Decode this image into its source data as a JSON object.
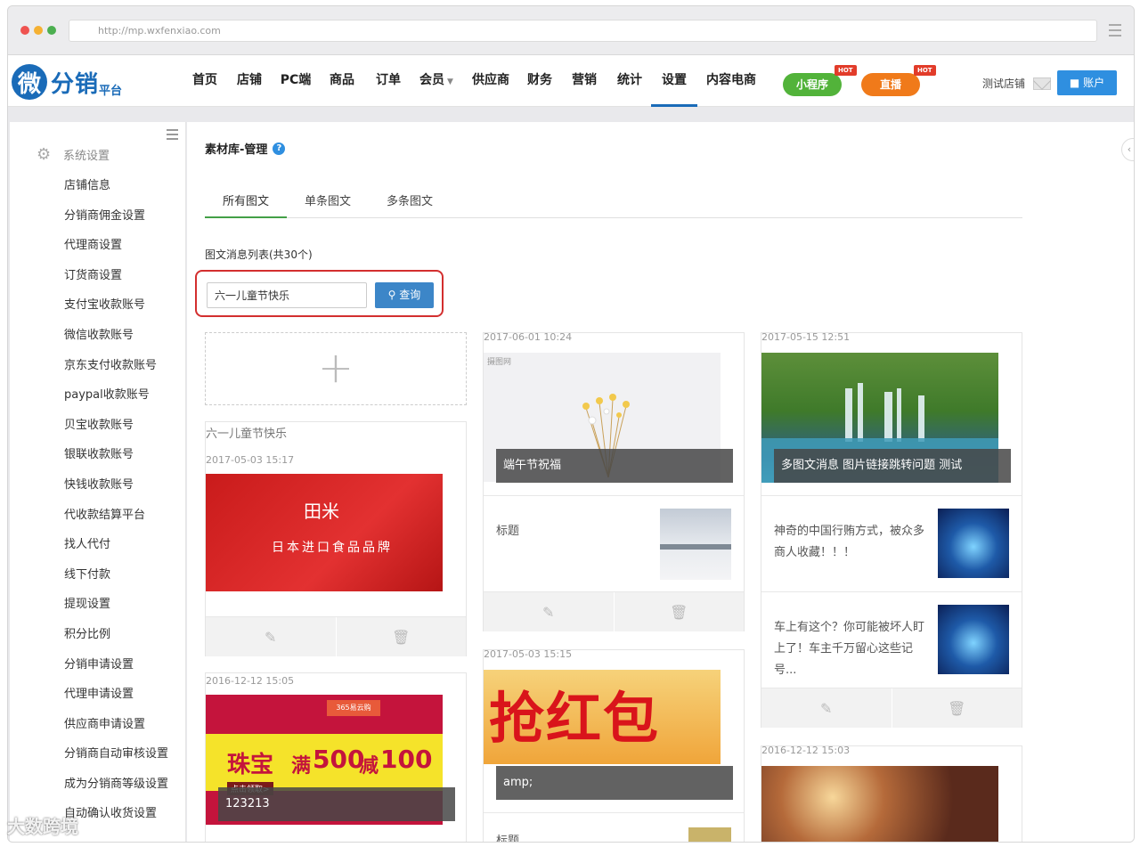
{
  "browser": {
    "url": "http://mp.wxfenxiao.com"
  },
  "header": {
    "logo_mark": "微",
    "logo_text": "分销",
    "logo_sub": "平台",
    "nav": [
      "首页",
      "店铺",
      "PC端",
      "商品",
      "订单",
      "会员",
      "供应商",
      "财务",
      "营销",
      "统计",
      "设置",
      "内容电商"
    ],
    "active_nav": "设置",
    "mini_program": "小程序",
    "live": "直播",
    "hot": "HOT",
    "store_name": "测试店铺",
    "account": "账户"
  },
  "sidebar": {
    "section": "系统设置",
    "items": [
      "店铺信息",
      "分销商佣金设置",
      "代理商设置",
      "订货商设置",
      "支付宝收款账号",
      "微信收款账号",
      "京东支付收款账号",
      "paypal收款账号",
      "贝宝收款账号",
      "银联收款账号",
      "快钱收款账号",
      "代收款结算平台",
      "找人代付",
      "线下付款",
      "提现设置",
      "积分比例",
      "分销申请设置",
      "代理申请设置",
      "供应商申请设置",
      "分销商自动审核设置",
      "成为分销商等级设置",
      "自动确认收货设置"
    ]
  },
  "main": {
    "title": "素材库-管理",
    "tabs": [
      "所有图文",
      "单条图文",
      "多条图文"
    ],
    "list_count": "图文消息列表(共30个)",
    "search_value": "六一儿童节快乐",
    "search_button": "查询",
    "add_symbol": "+"
  },
  "cards": {
    "c1": {
      "title": "六一儿童节快乐",
      "date": "2017-05-03 15:17",
      "image_caption": "日本进口食品品牌",
      "image_logo": "田米"
    },
    "c2": {
      "date": "2016-12-12 15:05",
      "overlay": "123213",
      "image_text_main": "珠宝",
      "image_text_full": "满",
      "image_text_num1": "500",
      "image_text_minus": "减",
      "image_text_num2": "100",
      "image_tag": "点击领取>",
      "image_badge": "365易云购"
    },
    "c3": {
      "date": "2017-06-01 10:24",
      "overlay": "端午节祝福",
      "sub_title": "标题",
      "image_mark": "摄图网"
    },
    "c4": {
      "date": "2017-05-03 15:15",
      "overlay": "amp;",
      "image_text": "抢红包",
      "sub_peek": "标题"
    },
    "c5": {
      "date": "2017-05-15 12:51",
      "overlay": "多图文消息 图片链接跳转问题 测试",
      "sub1": "神奇的中国行贿方式，被众多商人收藏！！！",
      "sub2": "车上有这个？你可能被坏人盯上了！车主千万留心这些记号..."
    },
    "c6": {
      "date": "2016-12-12 15:03"
    }
  },
  "icons": {
    "edit": "pencil-icon",
    "delete": "trash-icon"
  },
  "watermark": "大数跨境",
  "colors": {
    "brand": "#1a6bb8",
    "mini_program": "#52b33a",
    "live": "#f07a1a",
    "search_btn": "#3c86c8",
    "highlight": "#d32f2f"
  }
}
